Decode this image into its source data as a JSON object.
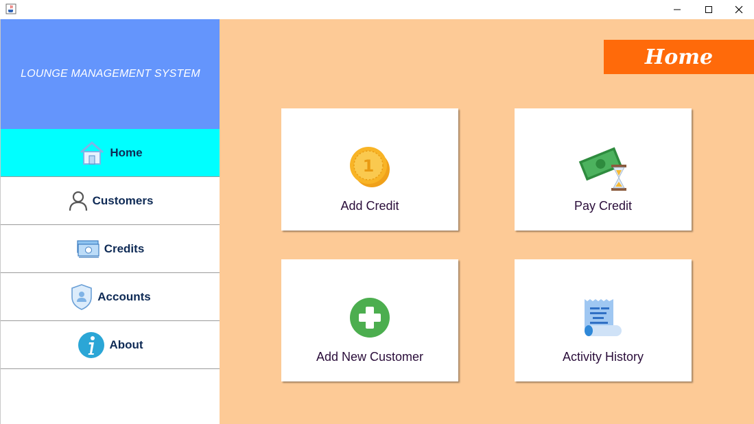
{
  "window": {
    "controls": {
      "minimize": "—",
      "maximize": "☐",
      "close": "✕"
    },
    "icons": {
      "app": "java-cup-icon"
    }
  },
  "sidebar": {
    "brand": "LOUNGE MANAGEMENT SYSTEM",
    "items": [
      {
        "label": "Home",
        "icon": "home-icon",
        "active": true
      },
      {
        "label": "Customers",
        "icon": "user-icon",
        "active": false
      },
      {
        "label": "Credits",
        "icon": "cash-icon",
        "active": false
      },
      {
        "label": "Accounts",
        "icon": "shield-user-icon",
        "active": false
      },
      {
        "label": "About",
        "icon": "info-icon",
        "active": false
      }
    ]
  },
  "main": {
    "page_title": "Home",
    "cards": [
      {
        "label": "Add Credit",
        "icon": "coin-icon"
      },
      {
        "label": "Pay Credit",
        "icon": "money-hourglass-icon"
      },
      {
        "label": "Add New Customer",
        "icon": "plus-circle-icon"
      },
      {
        "label": "Activity History",
        "icon": "receipt-scroll-icon"
      }
    ]
  },
  "colors": {
    "brand_bg": "#6495fc",
    "active_nav": "#00ffff",
    "main_bg": "#fdca96",
    "title_badge": "#ff6a0a",
    "nav_text": "#0e2a55"
  }
}
